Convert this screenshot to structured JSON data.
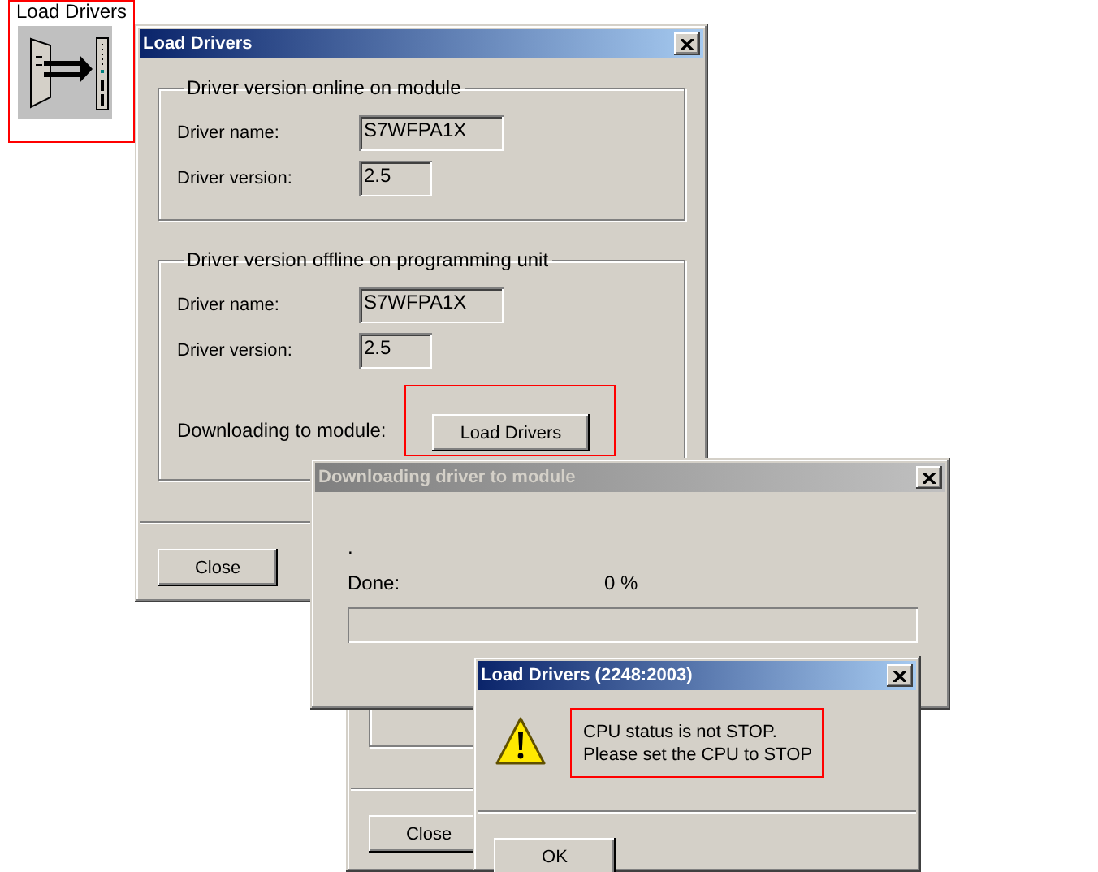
{
  "launcher": {
    "label": "Load Drivers",
    "highlighted": true
  },
  "load_drivers_dialog": {
    "title": "Load Drivers",
    "active": true,
    "groups": [
      {
        "title": "Driver version online on module",
        "fields": [
          {
            "label": "Driver name:",
            "value": "S7WFPA1X"
          },
          {
            "label": "Driver version:",
            "value": "2.5"
          }
        ]
      },
      {
        "title": "Driver version offline on programming unit",
        "fields": [
          {
            "label": "Driver name:",
            "value": "S7WFPA1X"
          },
          {
            "label": "Driver version:",
            "value": "2.5"
          }
        ]
      }
    ],
    "download_label": "Downloading to module:",
    "load_button": "Load Drivers",
    "load_button_highlighted": true,
    "close_button": "Close"
  },
  "background_dialog": {
    "close_button": "Close"
  },
  "download_dialog": {
    "title": "Downloading driver to module",
    "active": false,
    "status": ".",
    "done_label": "Done:",
    "percent": "0 %"
  },
  "message_box": {
    "title": "Load Drivers (2248:2003)",
    "active": true,
    "message_lines": [
      "CPU status is not STOP.",
      "Please set the CPU to STOP"
    ],
    "highlighted": true,
    "ok_button": "OK"
  }
}
